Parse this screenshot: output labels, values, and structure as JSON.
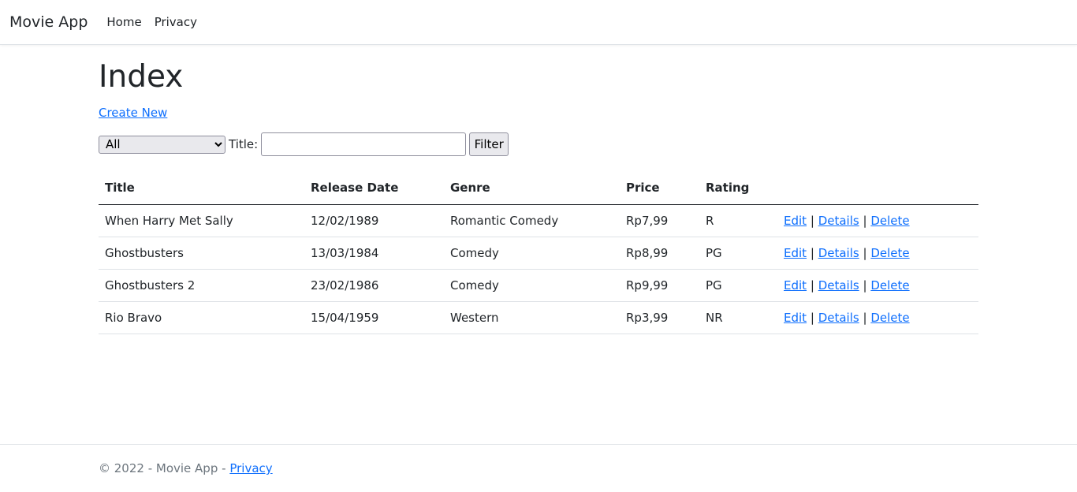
{
  "navbar": {
    "brand": "Movie App",
    "links": [
      "Home",
      "Privacy"
    ]
  },
  "page": {
    "title": "Index",
    "create_link": "Create New"
  },
  "filter": {
    "genre_selected": "All",
    "title_label": "Title:",
    "title_value": "",
    "button_label": "Filter"
  },
  "table": {
    "headers": [
      "Title",
      "Release Date",
      "Genre",
      "Price",
      "Rating",
      ""
    ],
    "rows": [
      {
        "title": "When Harry Met Sally",
        "release_date": "12/02/1989",
        "genre": "Romantic Comedy",
        "price": "Rp7,99",
        "rating": "R"
      },
      {
        "title": "Ghostbusters",
        "release_date": "13/03/1984",
        "genre": "Comedy",
        "price": "Rp8,99",
        "rating": "PG"
      },
      {
        "title": "Ghostbusters 2",
        "release_date": "23/02/1986",
        "genre": "Comedy",
        "price": "Rp9,99",
        "rating": "PG"
      },
      {
        "title": "Rio Bravo",
        "release_date": "15/04/1959",
        "genre": "Western",
        "price": "Rp3,99",
        "rating": "NR"
      }
    ],
    "actions": {
      "edit": "Edit",
      "details": "Details",
      "delete": "Delete",
      "separator": "|"
    }
  },
  "footer": {
    "text": "© 2022 - Movie App -",
    "privacy_link": "Privacy"
  },
  "colors": {
    "link": "#0d6efd",
    "text": "#212529",
    "muted": "#6c757d"
  }
}
